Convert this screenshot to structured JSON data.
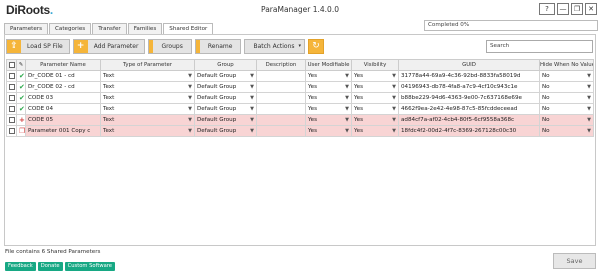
{
  "app": {
    "logo_main": "DiRoots",
    "logo_dot": ".",
    "title": "ParaManager 1.4.0.0"
  },
  "window": {
    "help": "?",
    "minimize": "—",
    "restore": "❐",
    "close": "✕"
  },
  "tabs": [
    "Parameters",
    "Categories",
    "Transfer",
    "Families",
    "Shared Editor"
  ],
  "active_tab": "Shared Editor",
  "progress": {
    "label": "Completed 0%",
    "value": 0
  },
  "toolbar": {
    "load": "Load SP File",
    "add": "Add Parameter",
    "groups": "Groups",
    "rename": "Rename",
    "batch": "Batch Actions"
  },
  "search": {
    "placeholder": "Search"
  },
  "table": {
    "headers": [
      "",
      "",
      "Parameter Name",
      "Type of Parameter",
      "Group",
      "Description",
      "User Modifiable",
      "Visibility",
      "GUID",
      "Hide When No Value"
    ],
    "rows": [
      {
        "status": "ok",
        "name": "Dr_CODE 01 - cd",
        "type": "Text",
        "group": "Default Group",
        "desc": "",
        "modifiable": "Yes",
        "visible": "Yes",
        "guid": "31778a44-69a9-4c36-92bd-8833fa58019d",
        "hide": "No",
        "highlight": false
      },
      {
        "status": "ok",
        "name": "Dr_CODE 02 - cd",
        "type": "Text",
        "group": "Default Group",
        "desc": "",
        "modifiable": "Yes",
        "visible": "Yes",
        "guid": "04196943-db78-4fa8-a7c9-4cf10c943c1e",
        "hide": "No",
        "highlight": false
      },
      {
        "status": "ok",
        "name": "CODE 03",
        "type": "Text",
        "group": "Default Group",
        "desc": "",
        "modifiable": "Yes",
        "visible": "Yes",
        "guid": "b88be229-94d6-4363-9e00-7c637168e69e",
        "hide": "No",
        "highlight": false
      },
      {
        "status": "ok",
        "name": "CODE 04",
        "type": "Text",
        "group": "Default Group",
        "desc": "",
        "modifiable": "Yes",
        "visible": "Yes",
        "guid": "4662f9ea-2e42-4e98-87c5-85fcddeceead",
        "hide": "No",
        "highlight": false
      },
      {
        "status": "add",
        "name": "CODE 05",
        "type": "Text",
        "group": "Default Group",
        "desc": "",
        "modifiable": "Yes",
        "visible": "Yes",
        "guid": "ad84cf7a-af02-4cb4-80f5-6cf9558a368c",
        "hide": "No",
        "highlight": true
      },
      {
        "status": "copy",
        "name": "Parameter 001 Copy c",
        "type": "Text",
        "group": "Default Group",
        "desc": "",
        "modifiable": "Yes",
        "visible": "Yes",
        "guid": "18fdc4f2-00d2-4f7c-8369-267128c00c30",
        "hide": "No",
        "highlight": true
      }
    ]
  },
  "status_text": "File contains 6 Shared Parameters",
  "links": [
    "Feedback",
    "Donate",
    "Custom Software"
  ],
  "save": "Save"
}
